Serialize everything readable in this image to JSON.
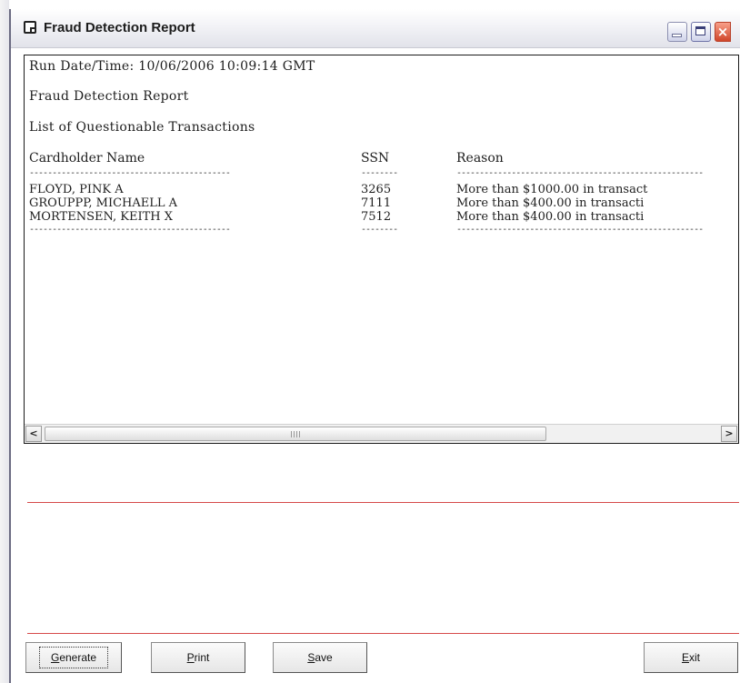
{
  "window": {
    "title": "Fraud Detection Report",
    "close_glyph": "×"
  },
  "report": {
    "run_line": "Run Date/Time: 10/06/2006 10:09:14 GMT",
    "heading": "Fraud Detection Report",
    "subheading": "List of Questionable Transactions",
    "columns": {
      "name": "Cardholder Name",
      "ssn": "SSN",
      "reason": "Reason"
    },
    "separator_name": "--------------------------------------------",
    "separator_ssn": "--------",
    "separator_reason": "------------------------------------------------------",
    "rows": [
      {
        "name": "FLOYD, PINK A",
        "ssn": "3265",
        "reason": "More than $1000.00 in transact"
      },
      {
        "name": "GROUPPP, MICHAELL A",
        "ssn": "7111",
        "reason": "More than $400.00 in transacti"
      },
      {
        "name": "MORTENSEN, KEITH X",
        "ssn": "7512",
        "reason": "More than $400.00 in transacti"
      }
    ]
  },
  "scrollbar": {
    "left_arrow": "<",
    "right_arrow": ">"
  },
  "buttons": {
    "generate": {
      "first": "G",
      "rest": "enerate"
    },
    "print": {
      "first": "P",
      "rest": "rint"
    },
    "save": {
      "first": "S",
      "rest": "ave"
    },
    "exit": {
      "first": "E",
      "rest": "xit"
    }
  },
  "colors": {
    "divider": "#d64a4a",
    "close_button": "#d0462a"
  },
  "icons": [
    "app-window-icon",
    "minimize-icon",
    "maximize-icon",
    "close-icon",
    "scroll-left-icon",
    "scroll-right-icon"
  ]
}
